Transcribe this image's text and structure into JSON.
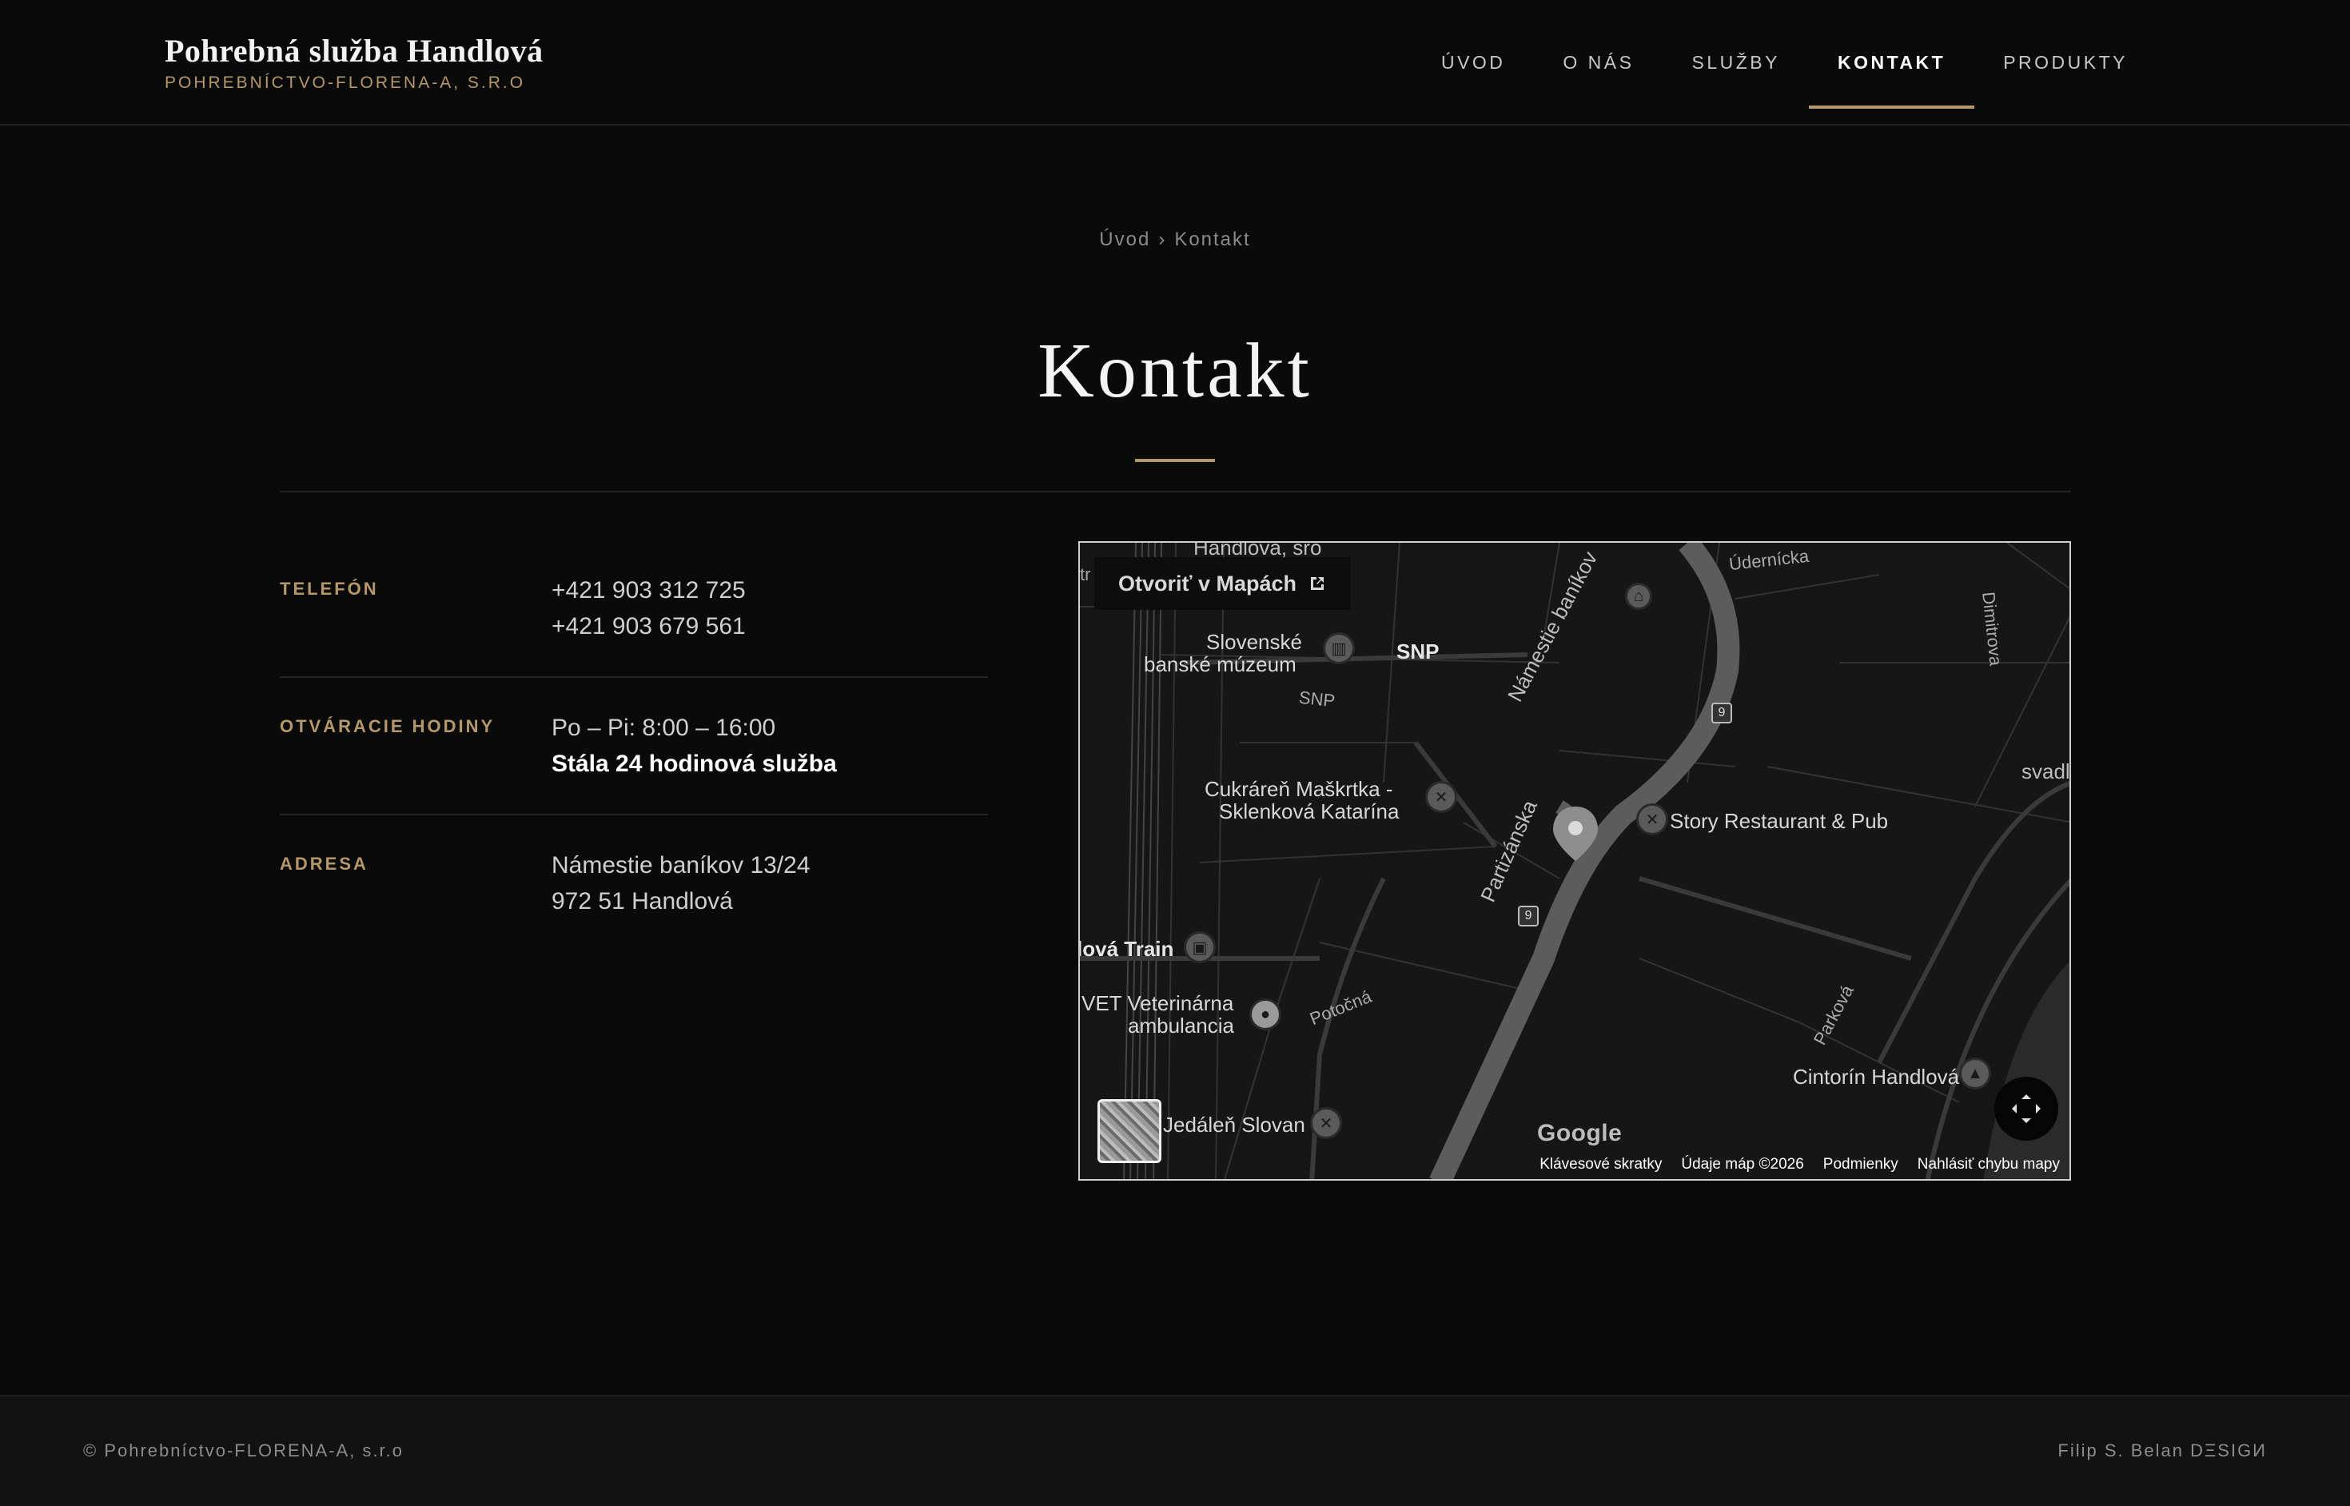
{
  "header": {
    "brand_title": "Pohrebná služba Handlová",
    "brand_subtitle": "POHREBNÍCTVO-FLORENA-A, S.R.O",
    "nav": [
      {
        "label": "ÚVOD"
      },
      {
        "label": "O NÁS"
      },
      {
        "label": "SLUŽBY"
      },
      {
        "label": "KONTAKT",
        "active": true
      },
      {
        "label": "PRODUKTY"
      }
    ]
  },
  "breadcrumb": {
    "home": "Úvod",
    "separator": "›",
    "current": "Kontakt"
  },
  "page_title": "Kontakt",
  "contact": {
    "phone": {
      "label": "TELEFÓN",
      "values": [
        "+421 903 312 725",
        "+421 903 679 561"
      ]
    },
    "hours": {
      "label": "OTVÁRACIE HODINY",
      "regular": "Po – Pi: 8:00 – 16:00",
      "highlight": "Stála 24 hodinová služba"
    },
    "address": {
      "label": "ADRESA",
      "line1": "Námestie baníkov 13/24",
      "line2": "972 51 Handlová"
    }
  },
  "map": {
    "open_in_maps": "Otvoriť v Mapách",
    "labels": {
      "top_partial": "Handlová, sro",
      "udernicka": "Údernícka",
      "museum_1": "Slovenské",
      "museum_2": "banské múzeum",
      "snp_1": "SNP",
      "snp_2": "SNP",
      "namestie": "Námestie baníkov",
      "dimitrova": "Dimitrova",
      "svadl": "svadl",
      "cukraren_1": "Cukráreň Maškrtka -",
      "cukraren_2": "Sklenková Katarína",
      "story": "Story Restaurant & Pub",
      "partizanska": "Partizánska",
      "train": "lová Train",
      "vet_1": "VET Veterinárna",
      "vet_2": "ambulancia",
      "potocna": "Potočná",
      "parkova": "Parková",
      "cintorin": "Cintorín Handlová",
      "jedalen": "Jedáleň Slovan",
      "route_9": "9",
      "tr": "tr"
    },
    "google": "Google",
    "footer": {
      "shortcuts": "Klávesové skratky",
      "data": "Údaje máp ©2026",
      "terms": "Podmienky",
      "report": "Nahlásiť chybu mapy"
    }
  },
  "footer": {
    "copyright": "© Pohrebníctvo-FLORENA-A, s.r.o",
    "credit": "Filip S. Belan DΞSIGИ"
  }
}
